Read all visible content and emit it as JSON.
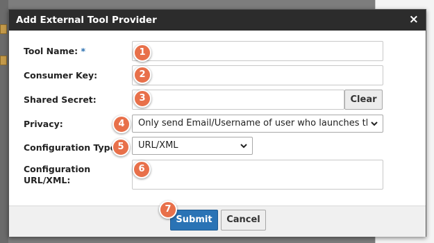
{
  "dialog": {
    "title": "Add External Tool Provider",
    "close_symbol": "×"
  },
  "form": {
    "tool_name_label": "Tool Name:",
    "required_marker": "*",
    "consumer_key_label": "Consumer Key:",
    "shared_secret_label": "Shared Secret:",
    "privacy_label": "Privacy:",
    "config_type_label": "Configuration Type:",
    "config_url_label_line1": "Configuration",
    "config_url_label_line2": "URL/XML:",
    "tool_name_value": "",
    "consumer_key_value": "",
    "shared_secret_value": "",
    "privacy_selected": "Only send Email/Username of user who launches the t",
    "config_type_selected": "URL/XML",
    "config_url_value": ""
  },
  "buttons": {
    "clear_label": "Clear",
    "submit_label": "Submit",
    "cancel_label": "Cancel"
  },
  "badges": [
    "1",
    "2",
    "3",
    "4",
    "5",
    "6",
    "7"
  ],
  "colors": {
    "titlebar": "#2c2c2c",
    "badge": "#e8704a",
    "submit": "#2a73b5",
    "required": "#2a6fb0"
  },
  "icons": {
    "close": "close-icon",
    "chevron": "chevron-down-icon"
  }
}
